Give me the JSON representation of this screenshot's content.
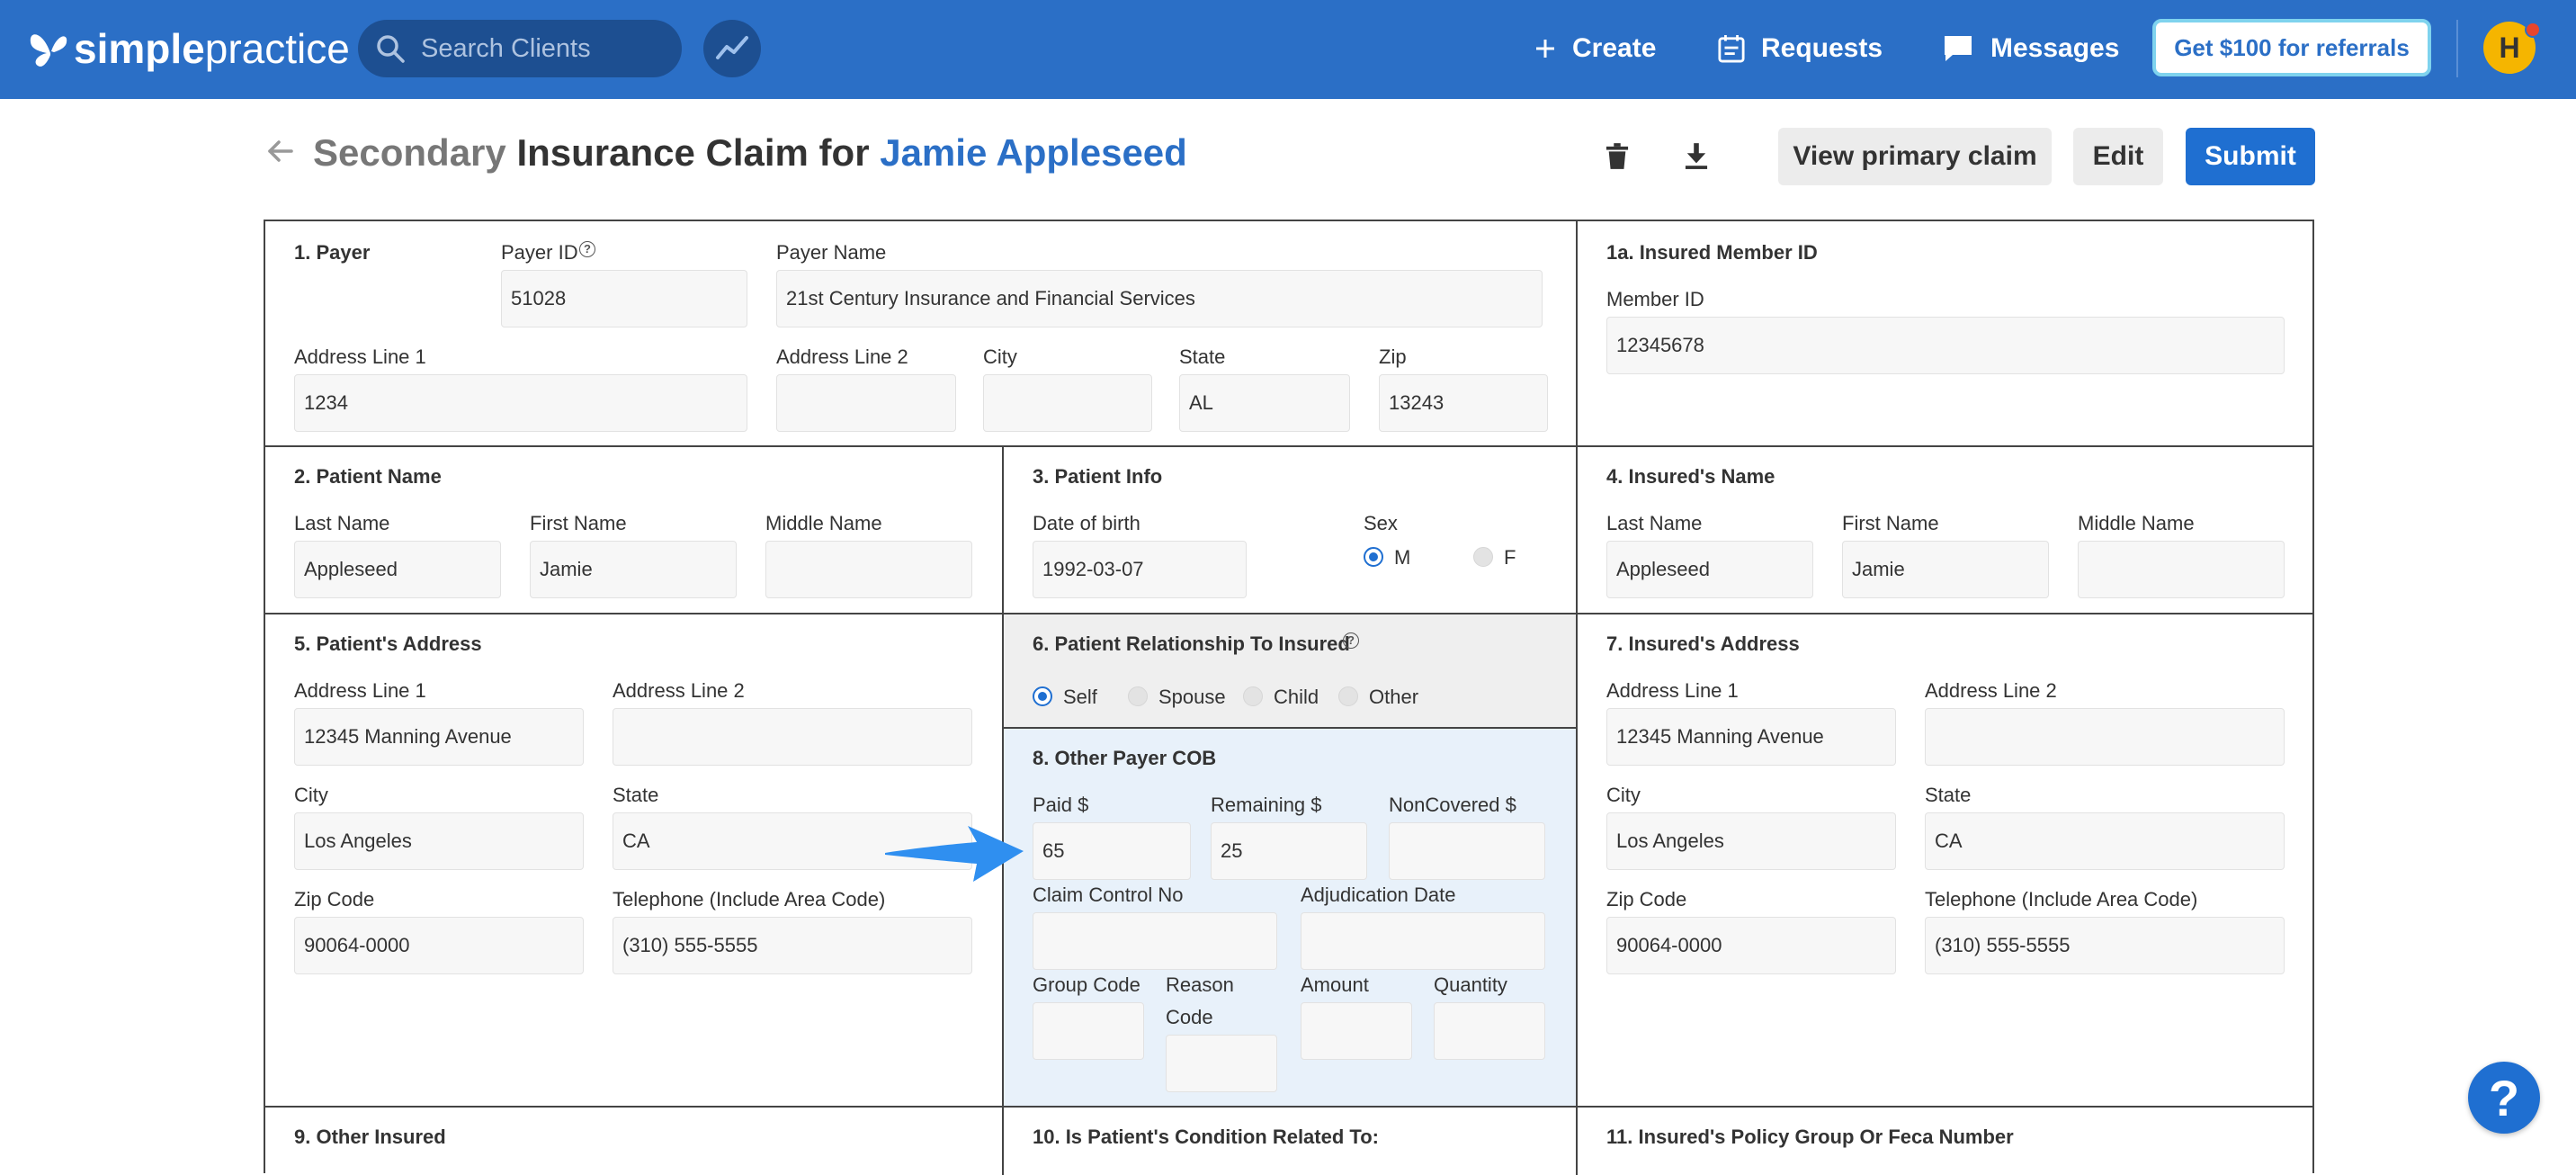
{
  "app": {
    "logo_bold": "simple",
    "logo_light": "practice",
    "search_placeholder": "Search Clients",
    "nav": {
      "create": "Create",
      "requests": "Requests",
      "messages": "Messages"
    },
    "referral": "Get $100 for referrals",
    "avatar_initial": "H",
    "colors": {
      "primary": "#2b6fc6",
      "button_blue": "#1f6fd1",
      "referral_border": "#7fd3ee",
      "avatar": "#f5b500",
      "cob_panel": "#e8f1fa"
    }
  },
  "header": {
    "title_prefix": "Secondary",
    "title_main": "Insurance Claim for",
    "client_name": "Jamie Appleseed",
    "view_primary": "View primary claim",
    "edit": "Edit",
    "submit": "Submit"
  },
  "s1": {
    "title": "1. Payer",
    "payer_id_label": "Payer ID",
    "payer_id": "51028",
    "payer_name_label": "Payer Name",
    "payer_name": "21st Century Insurance and Financial Services",
    "addr1_label": "Address Line 1",
    "addr1": "1234",
    "addr2_label": "Address Line 2",
    "addr2": "",
    "city_label": "City",
    "city": "",
    "state_label": "State",
    "state": "AL",
    "zip_label": "Zip",
    "zip": "13243"
  },
  "s1a": {
    "title": "1a. Insured Member ID",
    "member_label": "Member ID",
    "member_id": "12345678"
  },
  "s2": {
    "title": "2. Patient Name",
    "last_label": "Last Name",
    "last": "Appleseed",
    "first_label": "First Name",
    "first": "Jamie",
    "middle_label": "Middle Name",
    "middle": ""
  },
  "s3": {
    "title": "3. Patient Info",
    "dob_label": "Date of birth",
    "dob": "1992-03-07",
    "sex_label": "Sex",
    "sex_m": "M",
    "sex_f": "F",
    "sex_selected": "M"
  },
  "s4": {
    "title": "4. Insured's Name",
    "last_label": "Last Name",
    "last": "Appleseed",
    "first_label": "First Name",
    "first": "Jamie",
    "middle_label": "Middle Name",
    "middle": ""
  },
  "s5": {
    "title": "5. Patient's Address",
    "addr1_label": "Address Line 1",
    "addr1": "12345 Manning Avenue",
    "addr2_label": "Address Line 2",
    "addr2": "",
    "city_label": "City",
    "city": "Los Angeles",
    "state_label": "State",
    "state": "CA",
    "zip_label": "Zip Code",
    "zip": "90064-0000",
    "phone_label": "Telephone (Include Area Code)",
    "phone": "(310) 555-5555"
  },
  "s6": {
    "title": "6. Patient Relationship To Insured",
    "options": [
      "Self",
      "Spouse",
      "Child",
      "Other"
    ],
    "selected": "Self"
  },
  "s7": {
    "title": "7. Insured's Address",
    "addr1_label": "Address Line 1",
    "addr1": "12345 Manning Avenue",
    "addr2_label": "Address Line 2",
    "addr2": "",
    "city_label": "City",
    "city": "Los Angeles",
    "state_label": "State",
    "state": "CA",
    "zip_label": "Zip Code",
    "zip": "90064-0000",
    "phone_label": "Telephone (Include Area Code)",
    "phone": "(310) 555-5555"
  },
  "s8": {
    "title": "8. Other Payer COB",
    "paid_label": "Paid $",
    "paid": "65",
    "remaining_label": "Remaining $",
    "remaining": "25",
    "noncovered_label": "NonCovered $",
    "noncovered": "",
    "claim_control_label": "Claim Control No",
    "claim_control": "",
    "adjudication_label": "Adjudication Date",
    "adjudication": "",
    "group_code_label": "Group Code",
    "group_code": "",
    "reason_code_label_1": "Reason",
    "reason_code_label_2": "Code",
    "reason_code": "",
    "amount_label": "Amount",
    "amount": "",
    "quantity_label": "Quantity",
    "quantity": ""
  },
  "s9": {
    "title": "9. Other Insured"
  },
  "s10": {
    "title": "10. Is Patient's Condition Related To:"
  },
  "s11": {
    "title": "11. Insured's Policy Group Or Feca Number"
  },
  "help": {
    "symbol": "?"
  }
}
